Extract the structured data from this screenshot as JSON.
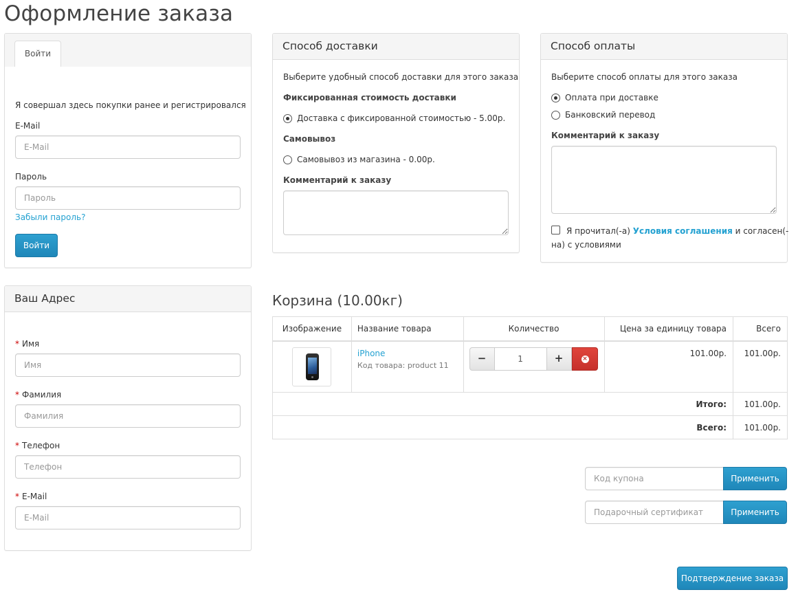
{
  "page_title": "Оформление заказа",
  "login": {
    "tab_label": "Войти",
    "intro": "Я совершал здесь покупки ранее и регистрировался",
    "email_label": "E-Mail",
    "email_placeholder": "E-Mail",
    "password_label": "Пароль",
    "password_placeholder": "Пароль",
    "forgot_link": "Забыли пароль?",
    "login_button": "Войти"
  },
  "address": {
    "title": "Ваш Адрес",
    "fields": [
      {
        "label": "Имя",
        "placeholder": "Имя"
      },
      {
        "label": "Фамилия",
        "placeholder": "Фамилия"
      },
      {
        "label": "Телефон",
        "placeholder": "Телефон"
      },
      {
        "label": "E-Mail",
        "placeholder": "E-Mail"
      }
    ],
    "required_mark": "*"
  },
  "delivery": {
    "title": "Способ доставки",
    "intro": "Выберите удобный способ доставки для этого заказа",
    "group1_title": "Фиксированная стоимость доставки",
    "option1": "Доставка с фиксированной стоимостью - 5.00р.",
    "group2_title": "Самовывоз",
    "option2": "Самовывоз из магазина - 0.00р.",
    "comment_label": "Комментарий к заказу"
  },
  "payment": {
    "title": "Способ оплаты",
    "intro": "Выберите способ оплаты для этого заказа",
    "option1": "Оплата при доставке",
    "option2": "Банковский перевод",
    "comment_label": "Комментарий к заказу",
    "agree_prefix": "Я прочитал(-а)",
    "agree_link": "Условия соглашения",
    "agree_suffix_1": "и согласен(-",
    "agree_suffix_2": "на) с условиями"
  },
  "cart": {
    "title": "Корзина (10.00кг)",
    "columns": [
      "Изображение",
      "Название товара",
      "Количество",
      "Цена за единицу товара",
      "Всего"
    ],
    "items": [
      {
        "name": "iPhone",
        "code": "Код товара: product 11",
        "quantity": "1",
        "unit_price": "101.00р.",
        "total": "101.00р."
      }
    ],
    "subtotal_label": "Итого:",
    "subtotal_value": "101.00р.",
    "total_label": "Всего:",
    "total_value": "101.00р.",
    "qty_minus": "−",
    "qty_plus": "+"
  },
  "coupon": {
    "placeholder": "Код купона",
    "button": "Применить"
  },
  "voucher": {
    "placeholder": "Подарочный сертификат",
    "button": "Применить"
  },
  "confirm_button": "Подтверждение заказа"
}
